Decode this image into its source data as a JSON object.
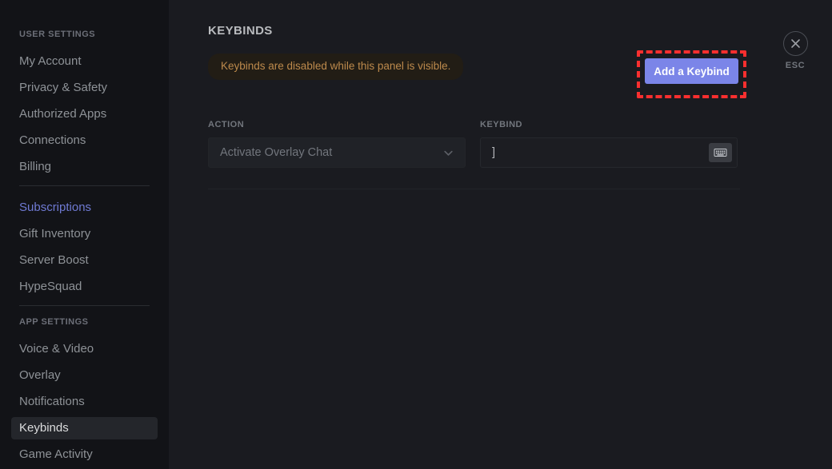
{
  "sidebar": {
    "user_settings_header": "USER SETTINGS",
    "app_settings_header": "APP SETTINGS",
    "user_items": [
      {
        "label": "My Account"
      },
      {
        "label": "Privacy & Safety"
      },
      {
        "label": "Authorized Apps"
      },
      {
        "label": "Connections"
      },
      {
        "label": "Billing"
      }
    ],
    "billing_items": [
      {
        "label": "Subscriptions"
      },
      {
        "label": "Gift Inventory"
      },
      {
        "label": "Server Boost"
      },
      {
        "label": "HypeSquad"
      }
    ],
    "app_items": [
      {
        "label": "Voice & Video"
      },
      {
        "label": "Overlay"
      },
      {
        "label": "Notifications"
      },
      {
        "label": "Keybinds"
      },
      {
        "label": "Game Activity"
      }
    ]
  },
  "main": {
    "title": "KEYBINDS",
    "warning": "Keybinds are disabled while this panel is visible.",
    "add_button_label": "Add a Keybind",
    "action_label": "ACTION",
    "action_value": "Activate Overlay Chat",
    "keybind_label": "KEYBIND",
    "keybind_value": "]",
    "chevron_icon": "chevron-down-icon",
    "keyboard_icon": "keyboard-icon"
  },
  "close": {
    "icon": "close-icon",
    "label": "ESC"
  },
  "colors": {
    "accent_blurple": "#7b85e8",
    "sidebar_accent": "#6f7ad3",
    "warning_text": "#bd8a4c",
    "warning_bg": "#221d15",
    "annotation_red": "#fa2f2f",
    "panel_bg": "#1a1b20",
    "sidebar_bg": "#121317"
  }
}
